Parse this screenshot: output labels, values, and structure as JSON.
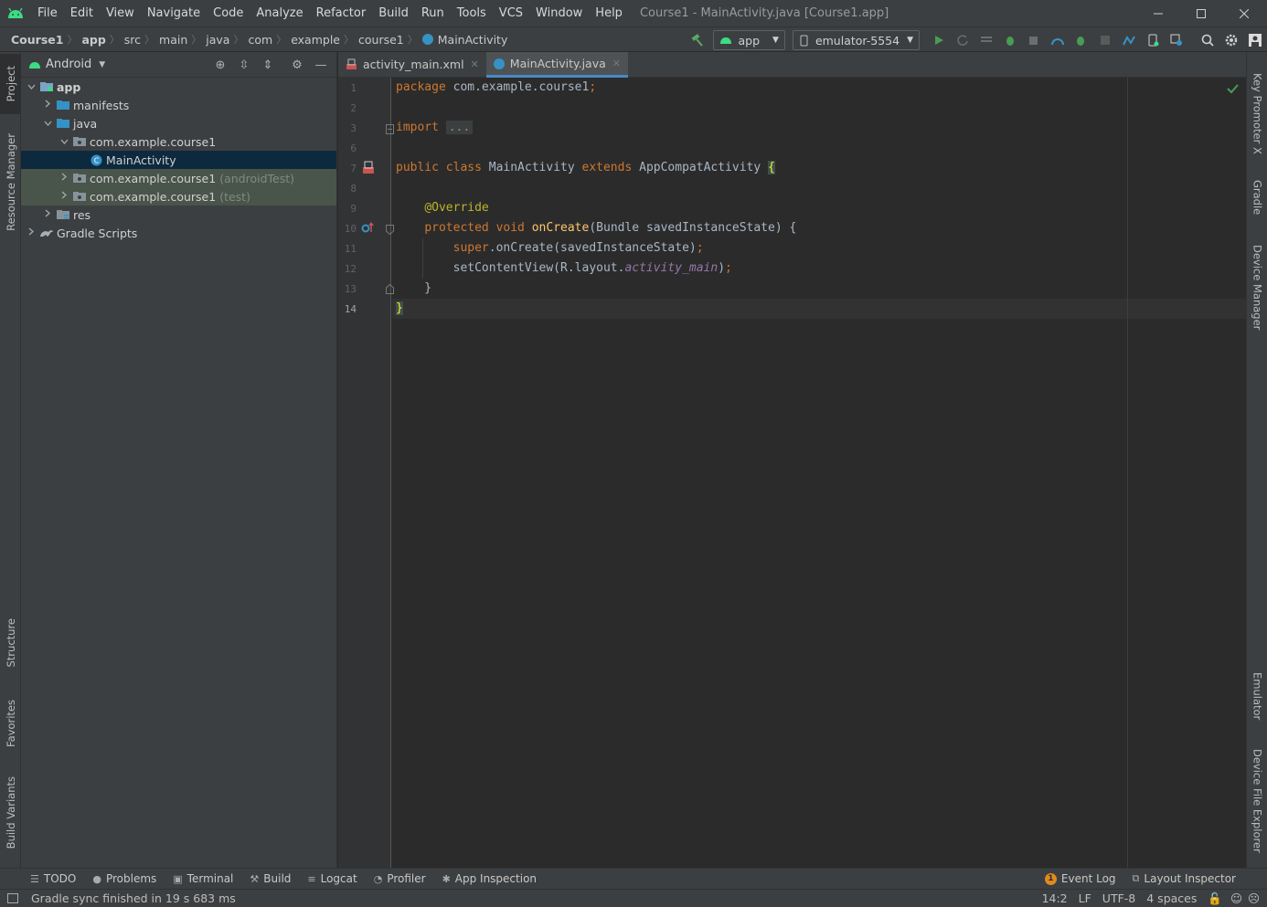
{
  "app": {
    "window_title": "Course1 - MainActivity.java [Course1.app]"
  },
  "menu": [
    "File",
    "Edit",
    "View",
    "Navigate",
    "Code",
    "Analyze",
    "Refactor",
    "Build",
    "Run",
    "Tools",
    "VCS",
    "Window",
    "Help"
  ],
  "breadcrumb": [
    "Course1",
    "app",
    "src",
    "main",
    "java",
    "com",
    "example",
    "course1",
    "MainActivity"
  ],
  "toolbar": {
    "run_config": "app",
    "device": "emulator-5554"
  },
  "project_panel": {
    "view_mode": "Android",
    "tree": [
      {
        "label": "app",
        "indent": 0,
        "expanded": true,
        "icon": "module-folder-icon",
        "bold": true
      },
      {
        "label": "manifests",
        "indent": 1,
        "expanded": false,
        "icon": "folder-icon"
      },
      {
        "label": "java",
        "indent": 1,
        "expanded": true,
        "icon": "folder-icon"
      },
      {
        "label": "com.example.course1",
        "indent": 2,
        "expanded": true,
        "icon": "package-icon"
      },
      {
        "label": "MainActivity",
        "indent": 3,
        "leaf": true,
        "icon": "class-icon",
        "selected": true
      },
      {
        "label": "com.example.course1",
        "suffix": "(androidTest)",
        "indent": 2,
        "expanded": false,
        "icon": "package-icon",
        "tested": true
      },
      {
        "label": "com.example.course1",
        "suffix": "(test)",
        "indent": 2,
        "expanded": false,
        "icon": "package-icon",
        "tested": true
      },
      {
        "label": "res",
        "indent": 1,
        "expanded": false,
        "icon": "res-folder-icon"
      },
      {
        "label": "Gradle Scripts",
        "indent": 0,
        "expanded": false,
        "icon": "gradle-icon"
      }
    ]
  },
  "left_tabs": [
    "Project",
    "Resource Manager",
    "Structure",
    "Favorites",
    "Build Variants"
  ],
  "right_tabs": [
    "Key Promoter X",
    "Gradle",
    "Device Manager",
    "Emulator",
    "Device File Explorer"
  ],
  "editor": {
    "tabs": [
      {
        "label": "activity_main.xml",
        "active": false
      },
      {
        "label": "MainActivity.java",
        "active": true
      }
    ],
    "line_numbers": [
      "1",
      "2",
      "3",
      "6",
      "7",
      "8",
      "9",
      "10",
      "11",
      "12",
      "13",
      "14"
    ],
    "current_line": "14"
  },
  "bottom_tools": [
    "TODO",
    "Problems",
    "Terminal",
    "Build",
    "Logcat",
    "Profiler",
    "App Inspection"
  ],
  "bottom_tools_right": [
    "Event Log",
    "Layout Inspector"
  ],
  "event_log_count": "1",
  "status": {
    "message": "Gradle sync finished in 19 s 683 ms",
    "position": "14:2",
    "line_sep": "LF",
    "encoding": "UTF-8",
    "indent": "4 spaces"
  },
  "colors": {
    "accent": "#4a88c7",
    "keyword": "#cc7832",
    "annotation": "#bbb529",
    "method": "#ffc66d",
    "field": "#9876aa",
    "selection": "#0d293e"
  }
}
